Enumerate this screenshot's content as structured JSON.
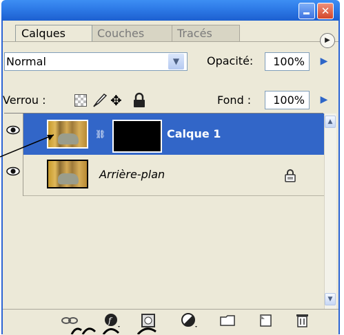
{
  "window": {
    "close_glyph": "✕"
  },
  "tabs": [
    {
      "label": "Calques"
    },
    {
      "label": "Couches"
    },
    {
      "label": "Tracés"
    }
  ],
  "blend": {
    "mode": "Normal",
    "opacity_label": "Opacité:",
    "opacity_value": "100%"
  },
  "lock": {
    "label": "Verrou :",
    "fill_label": "Fond :",
    "fill_value": "100%"
  },
  "layers": [
    {
      "name": "Calque 1",
      "selected": true,
      "visible": true,
      "has_mask": true
    },
    {
      "name": "Arrière-plan",
      "selected": false,
      "visible": true,
      "locked": true
    }
  ],
  "toolbar": {
    "icons": [
      "link-layers-icon",
      "layer-style-icon",
      "add-mask-icon",
      "adjustment-layer-icon",
      "new-group-icon",
      "new-layer-icon",
      "delete-layer-icon"
    ]
  },
  "colors": {
    "selection": "#3266c8",
    "panel": "#ece9d8",
    "titlebar": "#2f7ce8"
  }
}
